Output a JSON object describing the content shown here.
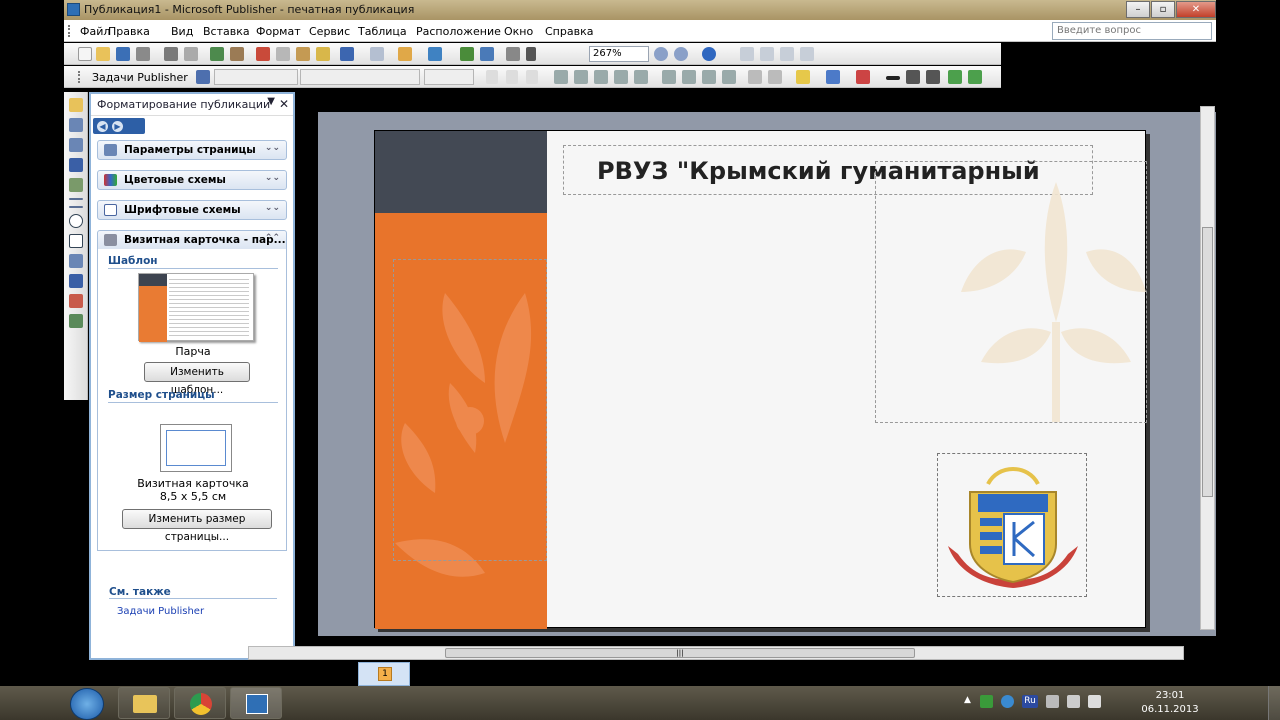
{
  "window": {
    "title": "Публикация1 - Microsoft Publisher - печатная публикация",
    "min": "–",
    "max": "▫",
    "close": "✕"
  },
  "menu": [
    "Файл",
    "Правка",
    "Вид",
    "Вставка",
    "Формат",
    "Сервис",
    "Таблица",
    "Расположение",
    "Окно",
    "Справка"
  ],
  "ask_placeholder": "Введите вопрос",
  "zoom": "267%",
  "tasks_label": "Задачи Publisher",
  "pane": {
    "title": "Форматирование публикации",
    "sections": [
      "Параметры страницы",
      "Цветовые схемы",
      "Шрифтовые схемы",
      "Визитная карточка - пар..."
    ],
    "template_heading": "Шаблон",
    "template_name": "Парча",
    "change_template": "Изменить шаблон...",
    "page_size_heading": "Размер страницы",
    "size_name": "Визитная карточка",
    "size_dims": "8,5 x 5,5 см",
    "change_size": "Изменить размер страницы...",
    "see_also": "См. также",
    "see_also_link": "Задачи Publisher"
  },
  "card": {
    "title": "РВУЗ \"Крымский гуманитарный"
  },
  "page_number": "1",
  "clock": {
    "time": "23:01",
    "date": "06.11.2013"
  },
  "tray_lang": "Ru",
  "colors": {
    "orange": "#e8742b",
    "dark": "#434954",
    "accent": "#2d5fa6"
  }
}
